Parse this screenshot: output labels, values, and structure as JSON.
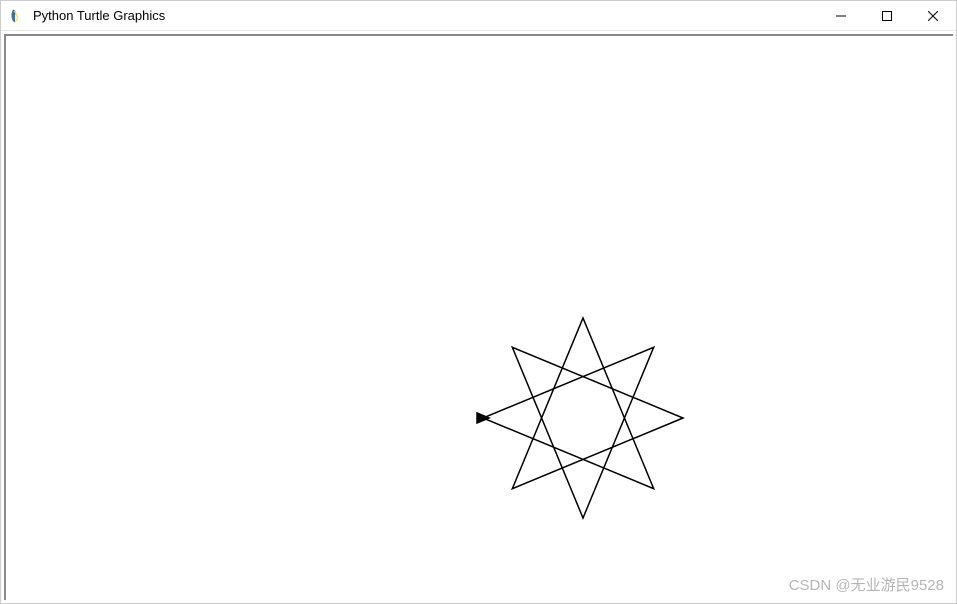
{
  "window": {
    "title": "Python Turtle Graphics",
    "icon_name": "python-feather-icon"
  },
  "controls": {
    "minimize": "Minimize",
    "maximize": "Maximize",
    "close": "Close"
  },
  "canvas": {
    "shape": "8-pointed-star",
    "turtle_heading": 0,
    "turtle_visible": true
  },
  "watermark": "CSDN @无业游民9528"
}
